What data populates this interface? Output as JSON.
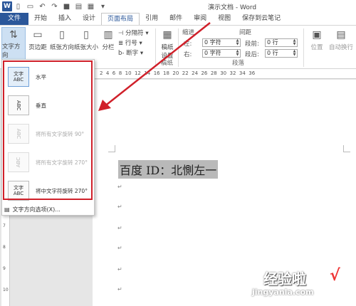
{
  "window": {
    "title": "演示文档 - Word"
  },
  "quick_access": [
    "word-logo",
    "open-icon",
    "new-icon",
    "undo-icon",
    "redo-icon",
    "save-icon",
    "print-icon",
    "table-icon",
    "more-icon"
  ],
  "tabs": [
    {
      "label": "文件",
      "name": "tab-file"
    },
    {
      "label": "开始",
      "name": "tab-home"
    },
    {
      "label": "插入",
      "name": "tab-insert"
    },
    {
      "label": "设计",
      "name": "tab-design"
    },
    {
      "label": "页面布局",
      "name": "tab-layout",
      "active": true
    },
    {
      "label": "引用",
      "name": "tab-references"
    },
    {
      "label": "邮件",
      "name": "tab-mailings"
    },
    {
      "label": "审阅",
      "name": "tab-review"
    },
    {
      "label": "视图",
      "name": "tab-view"
    },
    {
      "label": "保存到云笔记",
      "name": "tab-cloud-note"
    }
  ],
  "ribbon": {
    "text_direction": "文字方向",
    "margins": "页边距",
    "orientation": "纸张方向",
    "size": "纸张大小",
    "columns": "分栏",
    "breaks": "分隔符",
    "line_numbers": "行号",
    "hyphenation": "断字",
    "draft_line1": "稿纸",
    "draft_line2": "设置",
    "draft_group": "稿纸",
    "indent_label": "缩进",
    "spacing_label": "间距",
    "indent_left_label": "左:",
    "indent_right_label": "右:",
    "indent_left_value": "0 字符",
    "indent_right_value": "0 字符",
    "before_label": "段前:",
    "after_label": "段后:",
    "before_value": "0 行",
    "after_value": "0 行",
    "paragraph_group": "段落",
    "position": "位置",
    "wrap": "自动换行"
  },
  "ruler": {
    "marks": "2  4  6  8  10  12  14  16  18  20  22  24  26  28  30  32  34  36"
  },
  "vruler": [
    "1",
    "2",
    "3",
    "4",
    "5",
    "6",
    "7",
    "8",
    "9",
    "10"
  ],
  "document": {
    "line": "百度 ID：北惻左一"
  },
  "dropdown": {
    "items": [
      {
        "icon_text": "文字\nABC",
        "label": "水平",
        "enabled": true,
        "selected": true
      },
      {
        "icon_text": "ABC",
        "label": "垂直",
        "enabled": true
      },
      {
        "icon_text": "ABC",
        "label": "将所有文字旋转 90°",
        "enabled": false
      },
      {
        "icon_text": "ABC",
        "label": "将所有文字旋转 270°",
        "enabled": false
      },
      {
        "icon_text": "文字\nABC",
        "label": "将中文字符旋转 270°",
        "enabled": true
      }
    ],
    "options_label": "文字方向选项(X)..."
  },
  "watermark": {
    "text": "经验啦",
    "url": "jingyanla.com"
  },
  "colors": {
    "accent": "#2b579a",
    "highlight_border": "#d0202a",
    "arrow": "#d0202a"
  }
}
